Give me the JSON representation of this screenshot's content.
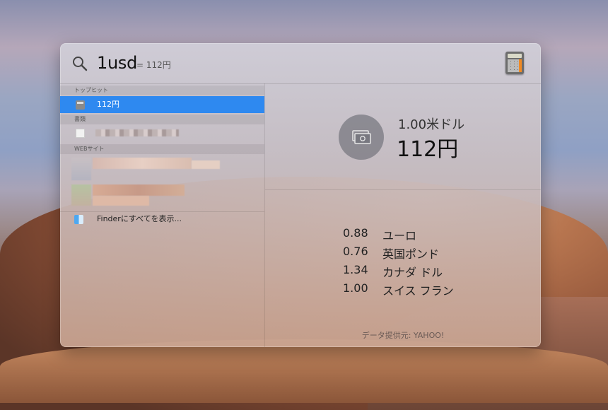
{
  "search": {
    "query": "1usd",
    "inline_result": "= 112円",
    "app_icon": "calculator-icon"
  },
  "sections": {
    "top_hit": "トップヒット",
    "documents": "書類",
    "web_sites": "WEBサイト"
  },
  "top_hit_item": {
    "label": "112円",
    "icon": "calculator-icon"
  },
  "finder_item": {
    "label": "Finderにすべてを表示...",
    "icon": "finder-icon"
  },
  "detail": {
    "from": "1.00米ドル",
    "to": "112円",
    "icon": "money-icon",
    "rates": [
      {
        "value": "0.88",
        "currency": "ユーロ"
      },
      {
        "value": "0.76",
        "currency": "英国ポンド"
      },
      {
        "value": "1.34",
        "currency": "カナダ ドル"
      },
      {
        "value": "1.00",
        "currency": "スイス フラン"
      }
    ],
    "source": "データ提供元: YAHOO!"
  },
  "colors": {
    "selection": "#2e89f0"
  }
}
